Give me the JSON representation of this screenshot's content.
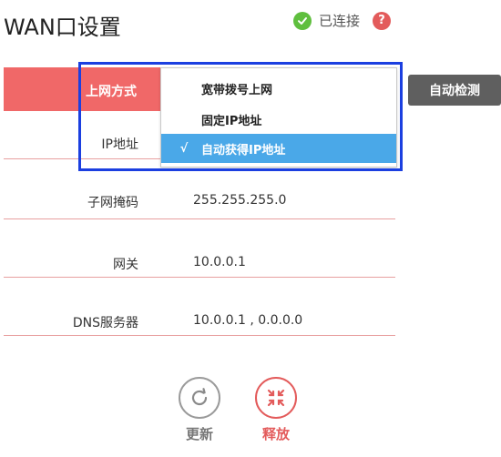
{
  "header": {
    "title": "WAN口设置",
    "status": "已连接",
    "help_symbol": "?"
  },
  "connection": {
    "label": "上网方式",
    "auto_detect": "自动检测",
    "dropdown": {
      "options": [
        "宽带拨号上网",
        "固定IP地址",
        "自动获得IP地址"
      ],
      "selected_index": 2,
      "selected_mark": "√"
    }
  },
  "fields": {
    "ip": {
      "label": "IP地址"
    },
    "subnet": {
      "label": "子网掩码",
      "value": "255.255.255.0"
    },
    "gateway": {
      "label": "网关",
      "value": "10.0.0.1"
    },
    "dns": {
      "label": "DNS服务器",
      "value": "10.0.0.1 , 0.0.0.0"
    }
  },
  "actions": {
    "refresh": "更新",
    "release": "释放"
  },
  "colors": {
    "accent_red": "#f06868",
    "selected_blue": "#4aa8e8",
    "highlight_blue": "#1b3fe0",
    "connected_green": "#5fbf3e"
  },
  "icons": {
    "status": "check-circle-icon",
    "help": "help-icon",
    "refresh": "refresh-icon",
    "release": "release-icon"
  }
}
